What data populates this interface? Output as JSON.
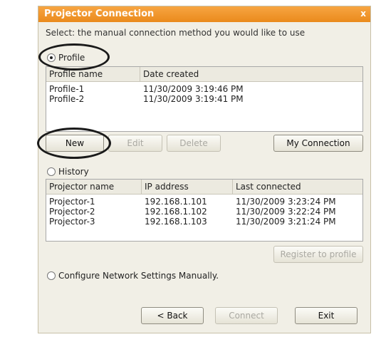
{
  "window": {
    "title": "Projector Connection",
    "close_glyph": "x"
  },
  "instruction": "Select: the manual connection method you would like to use",
  "profile_section": {
    "radio_label": "Profile",
    "columns": [
      "Profile name",
      "Date created"
    ],
    "rows": [
      {
        "name": "Profile-1",
        "date": "11/30/2009 3:19:46 PM"
      },
      {
        "name": "Profile-2",
        "date": "11/30/2009 3:19:41 PM"
      }
    ],
    "buttons": {
      "new": "New",
      "edit": "Edit",
      "delete": "Delete",
      "my_connection": "My Connection"
    }
  },
  "history_section": {
    "radio_label": "History",
    "columns": [
      "Projector name",
      "IP address",
      "Last connected"
    ],
    "rows": [
      {
        "name": "Projector-1",
        "ip": "192.168.1.101",
        "last": "11/30/2009 3:23:24 PM"
      },
      {
        "name": "Projector-2",
        "ip": "192.168.1.102",
        "last": "11/30/2009 3:22:24 PM"
      },
      {
        "name": "Projector-3",
        "ip": "192.168.1.103",
        "last": "11/30/2009 3:21:24 PM"
      }
    ],
    "register_button": "Register to profile"
  },
  "configure_option": {
    "radio_label": "Configure Network Settings Manually."
  },
  "footer": {
    "back": "< Back",
    "connect": "Connect",
    "exit": "Exit"
  }
}
